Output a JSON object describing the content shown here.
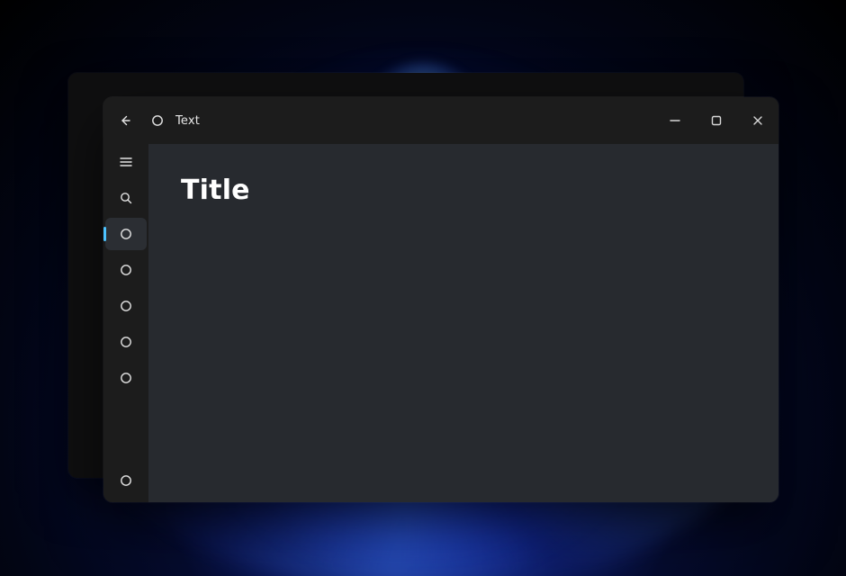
{
  "colors": {
    "accent": "#4cc2ff"
  },
  "titlebar": {
    "title": "Text"
  },
  "nav": {
    "items": [
      {
        "id": "item-1",
        "selected": true
      },
      {
        "id": "item-2",
        "selected": false
      },
      {
        "id": "item-3",
        "selected": false
      },
      {
        "id": "item-4",
        "selected": false
      },
      {
        "id": "item-5",
        "selected": false
      }
    ],
    "footer_item": {
      "id": "footer-item"
    }
  },
  "page": {
    "title": "Title"
  }
}
